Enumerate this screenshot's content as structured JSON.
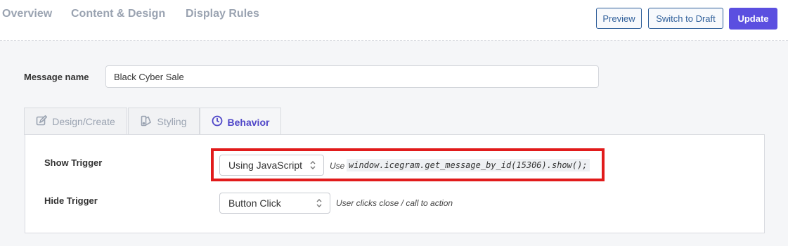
{
  "top_nav": {
    "tabs": [
      "Overview",
      "Content & Design",
      "Display Rules"
    ],
    "preview_label": "Preview",
    "draft_label": "Switch to Draft",
    "update_label": "Update"
  },
  "message": {
    "label": "Message name",
    "value": "Black Cyber Sale"
  },
  "tabs": [
    {
      "label": "Design/Create",
      "icon": "edit-icon"
    },
    {
      "label": "Styling",
      "icon": "palette-icon"
    },
    {
      "label": "Behavior",
      "icon": "clock-icon",
      "active": true
    }
  ],
  "behavior": {
    "show_trigger": {
      "label": "Show Trigger",
      "selected": "Using JavaScript",
      "hint_prefix": "Use",
      "code": "window.icegram.get_message_by_id(15306).show();"
    },
    "hide_trigger": {
      "label": "Hide Trigger",
      "selected": "Button Click",
      "hint": "User clicks close / call to action"
    }
  },
  "colors": {
    "accent": "#5b4fe0",
    "active_tab": "#4f46c8",
    "highlight": "#e11b1b",
    "muted": "#9aa3b1"
  }
}
